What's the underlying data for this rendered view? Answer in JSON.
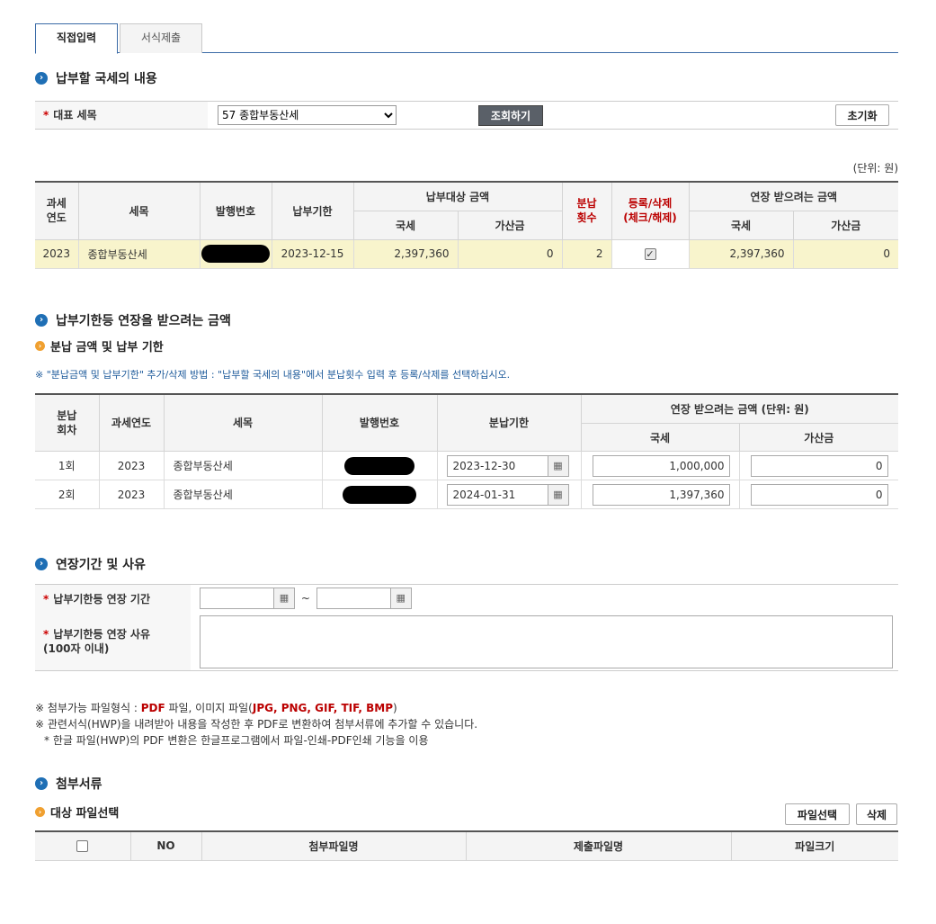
{
  "tabs": [
    "직접입력",
    "서식제출"
  ],
  "section1": {
    "title": "납부할 국세의 내용",
    "tax_label": "대표 세목",
    "tax_selected": "57 종합부동산세",
    "search_button": "조회하기",
    "reset_button": "초기화",
    "unit": "(단위: 원)",
    "headers": {
      "year": "과세\n연도",
      "tax": "세목",
      "issue_no": "발행번호",
      "due": "납부기한",
      "target_amount": "납부대상 금액",
      "national": "국세",
      "penalty": "가산금",
      "install_count": "분납\n횟수",
      "register": "등록/삭제\n(체크/해제)",
      "ext_amount": "연장 받으려는 금액",
      "ext_national": "국세",
      "ext_penalty": "가산금"
    },
    "row": {
      "year": "2023",
      "tax": "종합부동산세",
      "due": "2023-12-15",
      "national": "2,397,360",
      "penalty": "0",
      "count": "2",
      "ext_national": "2,397,360",
      "ext_penalty": "0"
    }
  },
  "section2": {
    "title": "납부기한등 연장을 받으려는 금액",
    "subtitle": "분납 금액 및 납부 기한",
    "note": "※ \"분납금액 및 납부기한\" 추가/삭제 방법 : \"납부할 국세의 내용\"에서 분납횟수 입력 후 등록/삭제를 선택하십시오.",
    "headers": {
      "round": "분납\n회차",
      "year": "과세연도",
      "tax": "세목",
      "issue_no": "발행번호",
      "due": "분납기한",
      "ext": "연장 받으려는 금액 (단위: 원)",
      "national": "국세",
      "penalty": "가산금"
    },
    "rows": [
      {
        "round": "1회",
        "year": "2023",
        "tax": "종합부동산세",
        "due": "2023-12-30",
        "national": "1,000,000",
        "penalty": "0"
      },
      {
        "round": "2회",
        "year": "2023",
        "tax": "종합부동산세",
        "due": "2024-01-31",
        "national": "1,397,360",
        "penalty": "0"
      }
    ]
  },
  "section3": {
    "title": "연장기간 및 사유",
    "period_label": "납부기한등 연장 기간",
    "tilde": "~",
    "reason_label": "납부기한등 연장 사유",
    "reason_limit": "(100자 이내)"
  },
  "notes": {
    "line1_a": "※ 첨부가능 파일형식 : ",
    "line1_pdf": "PDF",
    "line1_b": " 파일, 이미지 파일(",
    "line1_img": "JPG, PNG, GIF, TIF, BMP",
    "line1_c": ")",
    "line2": "※ 관련서식(HWP)을 내려받아 내용을 작성한 후 PDF로 변환하여 첨부서류에 추가할 수 있습니다.",
    "line3": "* 한글 파일(HWP)의 PDF 변환은 한글프로그램에서 파일-인쇄-PDF인쇄 기능을 이용"
  },
  "section4": {
    "title": "첨부서류",
    "subtitle": "대상 파일선택",
    "select_button": "파일선택",
    "delete_button": "삭제",
    "headers": {
      "no": "NO",
      "attach": "첨부파일명",
      "submit": "제출파일명",
      "size": "파일크기"
    }
  },
  "colors": {
    "accent": "#1f6fb5",
    "highlight_row": "#f8f4cc",
    "required": "#cc0000"
  },
  "icons": [
    "arrow-circle-icon",
    "calendar-icon",
    "checkbox-icon"
  ]
}
